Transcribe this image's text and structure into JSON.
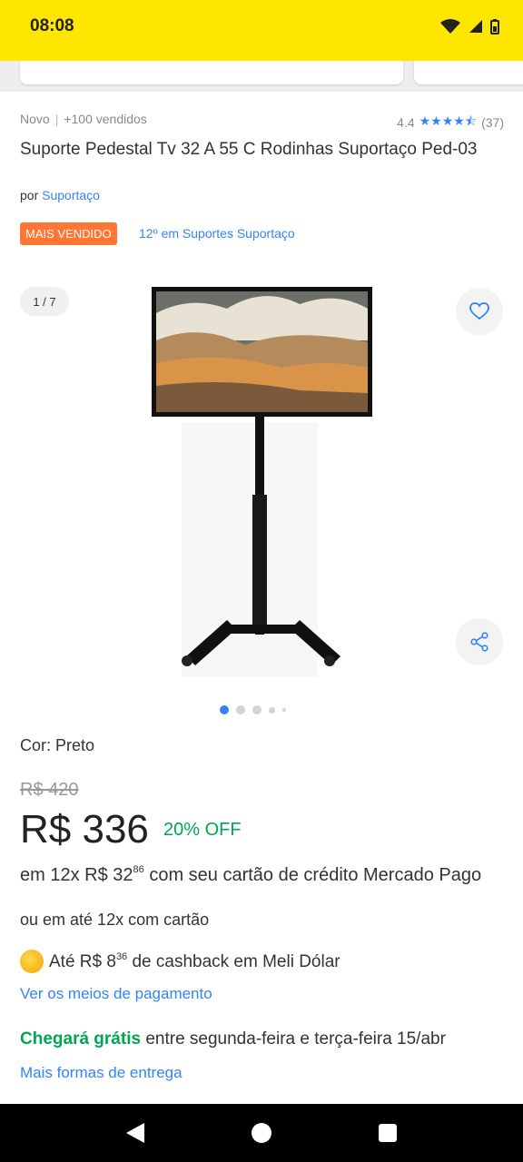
{
  "status": {
    "time": "08:08"
  },
  "product": {
    "condition": "Novo",
    "sold": "+100 vendidos",
    "rating": "4.4",
    "reviews": "(37)",
    "title": "Suporte Pedestal Tv 32 A 55 C Rodinhas Suportaço Ped-03",
    "seller_prefix": "por",
    "seller": "Suportaço",
    "badge": "MAIS VENDIDO",
    "rank": "12º em Suportes Suportaço",
    "image_counter": "1 / 7",
    "gallery_dots": 5,
    "gallery_active": 1
  },
  "variant": {
    "label": "Cor:",
    "value": "Preto"
  },
  "pricing": {
    "old_price": "R$ 420",
    "price": "R$ 336",
    "discount": "20% OFF",
    "inst_pre": "em 12x R$ 32",
    "inst_cents": "86",
    "inst_post": "com seu cartão de crédito Mercado Pago",
    "or_line": "ou em até 12x com cartão",
    "cash_pre": "Até R$ 8",
    "cash_cents": "36",
    "cash_post": "de cashback em Meli Dólar",
    "payment_link": "Ver os meios de pagamento"
  },
  "shipping": {
    "free_label": "Chegará grátis",
    "window": "entre segunda-feira e terça-feira 15/abr",
    "more_link": "Mais formas de entrega"
  },
  "colors": {
    "accent": "#3483fa",
    "yellow": "#ffe600",
    "green": "#00a650",
    "badge": "#ff7733"
  }
}
